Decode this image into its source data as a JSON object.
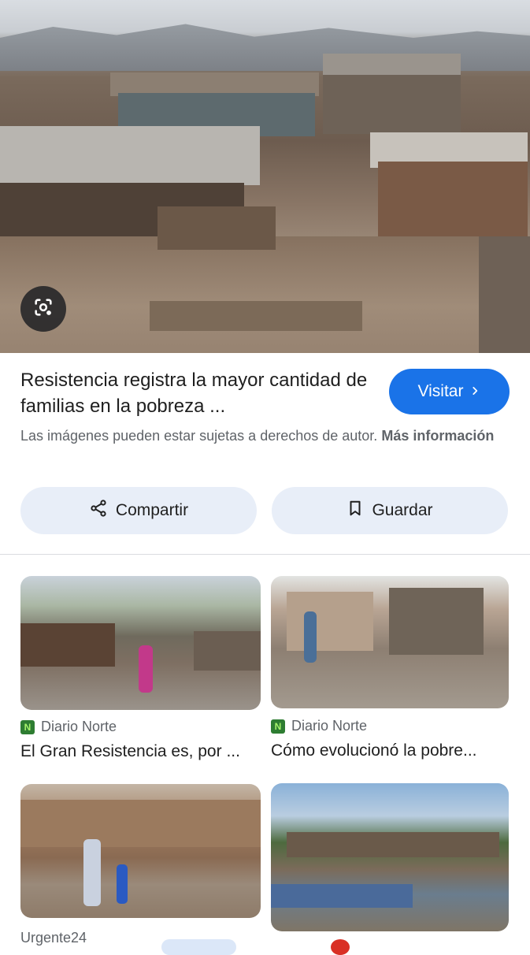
{
  "result": {
    "title": "Resistencia registra la mayor cantidad de familias en la pobreza ...",
    "visit_label": "Visitar",
    "copyright_text": "Las imágenes pueden estar sujetas a derechos de autor.",
    "more_info_label": "Más información",
    "share_label": "Compartir",
    "save_label": "Guardar"
  },
  "related": [
    {
      "source": "Diario Norte",
      "caption": "El Gran Resistencia es, por ..."
    },
    {
      "source": "Diario Norte",
      "caption": "Cómo evolucionó la pobre..."
    },
    {
      "source": "Urgente24",
      "caption": ""
    },
    {
      "source": "",
      "caption": ""
    }
  ],
  "colors": {
    "accent": "#1a73e8",
    "pill_bg": "#e8eef8",
    "favicon": "#2e7d32"
  },
  "icons": {
    "lens": "google-lens-icon",
    "share": "share-icon",
    "save": "bookmark-icon",
    "chevron": "chevron-right-icon"
  }
}
